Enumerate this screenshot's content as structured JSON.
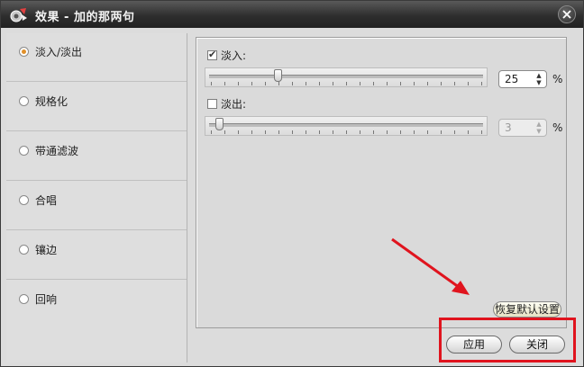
{
  "window": {
    "title": "效果 - 加的那两句"
  },
  "sidebar": {
    "items": [
      {
        "label": "淡入/淡出",
        "selected": true
      },
      {
        "label": "规格化",
        "selected": false
      },
      {
        "label": "带通滤波",
        "selected": false
      },
      {
        "label": "合唱",
        "selected": false
      },
      {
        "label": "镶边",
        "selected": false
      },
      {
        "label": "回响",
        "selected": false
      }
    ]
  },
  "fade_in": {
    "label": "淡入:",
    "checked": true,
    "value": "25",
    "unit": "%",
    "level_percent": 25,
    "enabled": true
  },
  "fade_out": {
    "label": "淡出:",
    "checked": false,
    "value": "3",
    "unit": "%",
    "level_percent": 3,
    "enabled": false
  },
  "buttons": {
    "reset": "恢复默认设置",
    "apply": "应用",
    "close": "关闭"
  },
  "colors": {
    "annotation": "#e0141e",
    "radio_selected": "#e0902a"
  },
  "icons": {
    "app": "app-logo-icon",
    "close": "close-icon",
    "check": "check-icon"
  }
}
